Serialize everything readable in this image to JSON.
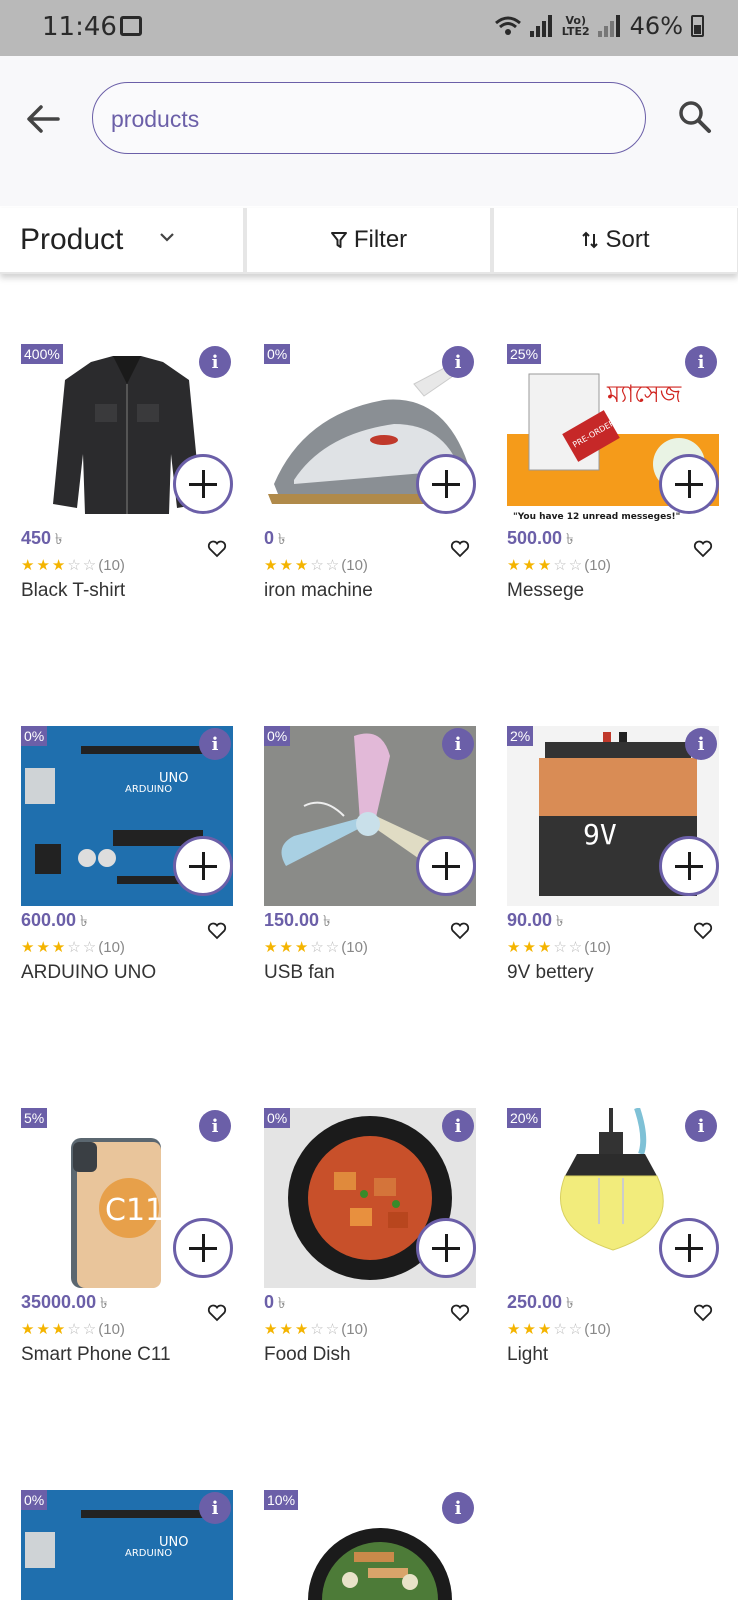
{
  "status": {
    "time": "11:46",
    "volte": "Vo)\nLTE2",
    "battery": "46%"
  },
  "search": {
    "value": "products",
    "placeholder": ""
  },
  "toolbar": {
    "product_label": "Product",
    "filter_label": "Filter",
    "sort_label": "Sort"
  },
  "currency": "৳",
  "rating": {
    "stars": 3,
    "max": 5,
    "count_label": "(10)"
  },
  "products": [
    {
      "discount": "400%",
      "price": "450",
      "name": "Black T-shirt",
      "image": "jacket"
    },
    {
      "discount": "0%",
      "price": "0",
      "name": "iron machine",
      "image": "iron"
    },
    {
      "discount": "25%",
      "price": "500.00",
      "name": "Messege",
      "image": "book"
    },
    {
      "discount": "0%",
      "price": "600.00",
      "name": "ARDUINO UNO",
      "image": "arduino"
    },
    {
      "discount": "0%",
      "price": "150.00",
      "name": "USB fan",
      "image": "fan"
    },
    {
      "discount": "2%",
      "price": "90.00",
      "name": "9V bettery",
      "image": "battery"
    },
    {
      "discount": "5%",
      "price": "35000.00",
      "name": "Smart Phone C11",
      "image": "phone"
    },
    {
      "discount": "0%",
      "price": "0",
      "name": "Food Dish",
      "image": "food"
    },
    {
      "discount": "20%",
      "price": "250.00",
      "name": "Light",
      "image": "bulb"
    },
    {
      "discount": "0%",
      "price": "",
      "name": "",
      "image": "arduino"
    },
    {
      "discount": "10%",
      "price": "",
      "name": "",
      "image": "bowl"
    }
  ],
  "image_texts": {
    "arduino_logo": "UNO",
    "arduino_brand": "ARDUINO",
    "battery_label": "9V",
    "phone_label": "C11",
    "book_title": "ম্যাসেজ",
    "book_banner": "\"You have 12 unread messeges!\"",
    "book_badge": "PRE-ORDER NOW!"
  }
}
